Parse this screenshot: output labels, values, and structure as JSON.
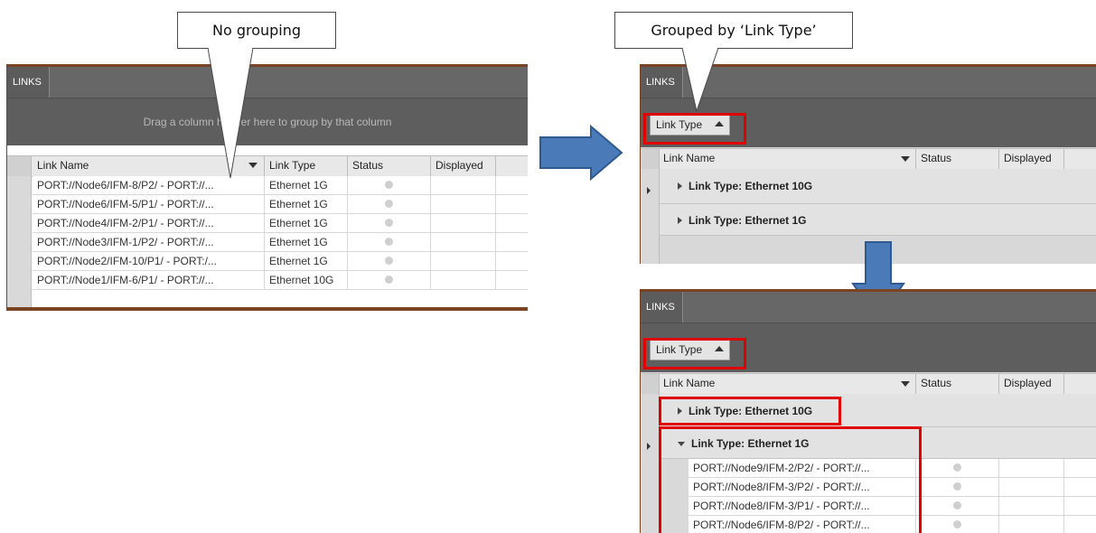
{
  "callouts": {
    "no_grouping": "No grouping",
    "grouped_by": "Grouped by ‘Link Type’"
  },
  "panel_left": {
    "tab_title": "LINKS",
    "drag_hint": "Drag a column header here to group by that column",
    "columns": [
      "Link Name",
      "Link Type",
      "Status",
      "Displayed"
    ],
    "rows": [
      {
        "name": "PORT://Node6/IFM-8/P2/ - PORT://...",
        "type": "Ethernet 1G"
      },
      {
        "name": "PORT://Node6/IFM-5/P1/ - PORT://...",
        "type": "Ethernet 1G"
      },
      {
        "name": "PORT://Node4/IFM-2/P1/ - PORT://...",
        "type": "Ethernet 1G"
      },
      {
        "name": "PORT://Node3/IFM-1/P2/ - PORT://...",
        "type": "Ethernet 1G"
      },
      {
        "name": "PORT://Node2/IFM-10/P1/ - PORT:/...",
        "type": "Ethernet 1G"
      },
      {
        "name": "PORT://Node1/IFM-6/P1/ - PORT://...",
        "type": "Ethernet 10G"
      }
    ]
  },
  "panel_top_right": {
    "tab_title": "LINKS",
    "group_chip": "Link Type",
    "columns": [
      "Link Name",
      "Status",
      "Displayed"
    ],
    "groups": [
      "Link Type: Ethernet 10G",
      "Link Type: Ethernet 1G"
    ]
  },
  "panel_bottom_right": {
    "tab_title": "LINKS",
    "group_chip": "Link Type",
    "columns": [
      "Link Name",
      "Status",
      "Displayed"
    ],
    "groups": [
      "Link Type: Ethernet 10G",
      "Link Type: Ethernet 1G"
    ],
    "rows": [
      "PORT://Node9/IFM-2/P2/ - PORT://...",
      "PORT://Node8/IFM-3/P2/ - PORT://...",
      "PORT://Node8/IFM-3/P1/ - PORT://...",
      "PORT://Node6/IFM-8/P2/ - PORT://..."
    ]
  },
  "icons": [
    "right-arrow-icon",
    "down-arrow-icon",
    "sort-down-icon",
    "sort-up-icon",
    "expand-icon",
    "collapse-icon",
    "status-dot-icon"
  ],
  "colors": {
    "highlight": "#e00000",
    "arrow": "#4a7ab8",
    "panel_border": "#7a4424"
  }
}
